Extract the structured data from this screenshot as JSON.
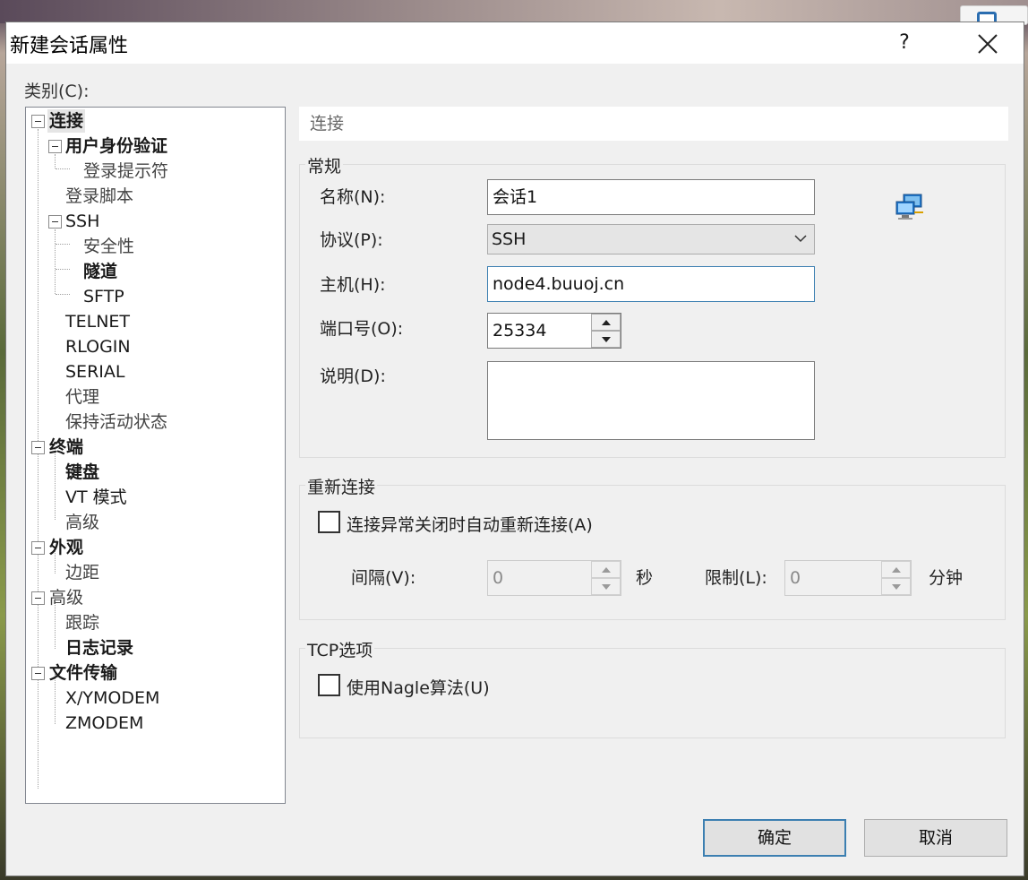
{
  "dialog": {
    "title": "新建会话属性",
    "help_label": "?",
    "category_label": "类别(C):"
  },
  "tree": {
    "items": [
      {
        "label": "连接",
        "bold": true
      },
      {
        "label": "用户身份验证",
        "bold": true
      },
      {
        "label": "登录提示符"
      },
      {
        "label": "登录脚本"
      },
      {
        "label": "SSH"
      },
      {
        "label": "安全性"
      },
      {
        "label": "隧道",
        "bold": true
      },
      {
        "label": "SFTP"
      },
      {
        "label": "TELNET"
      },
      {
        "label": "RLOGIN"
      },
      {
        "label": "SERIAL"
      },
      {
        "label": "代理"
      },
      {
        "label": "保持活动状态"
      },
      {
        "label": "终端",
        "bold": true
      },
      {
        "label": "键盘",
        "bold": true
      },
      {
        "label": "VT 模式"
      },
      {
        "label": "高级"
      },
      {
        "label": "外观",
        "bold": true
      },
      {
        "label": "边距"
      },
      {
        "label": "高级"
      },
      {
        "label": "跟踪"
      },
      {
        "label": "日志记录",
        "bold": true
      },
      {
        "label": "文件传输",
        "bold": true
      },
      {
        "label": "X/YMODEM"
      },
      {
        "label": "ZMODEM"
      }
    ]
  },
  "panel": {
    "header": "连接",
    "general": {
      "title": "常规",
      "name_label": "名称(N):",
      "name_value": "会话1",
      "protocol_label": "协议(P):",
      "protocol_value": "SSH",
      "host_label": "主机(H):",
      "host_value": "node4.buuoj.cn",
      "port_label": "端口号(O):",
      "port_value": "25334",
      "desc_label": "说明(D):",
      "desc_value": ""
    },
    "reconnect": {
      "title": "重新连接",
      "auto_label": "连接异常关闭时自动重新连接(A)",
      "auto_checked": false,
      "interval_label": "间隔(V):",
      "interval_value": "0",
      "interval_unit": "秒",
      "limit_label": "限制(L):",
      "limit_value": "0",
      "limit_unit": "分钟"
    },
    "tcp": {
      "title": "TCP选项",
      "nagle_label": "使用Nagle算法(U)",
      "nagle_checked": false
    }
  },
  "buttons": {
    "ok": "确定",
    "cancel": "取消"
  }
}
